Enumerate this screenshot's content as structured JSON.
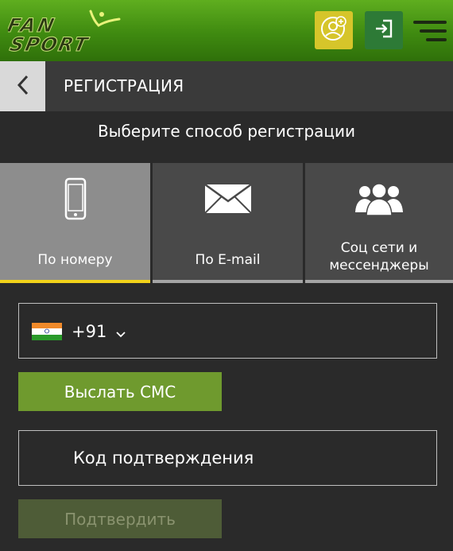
{
  "header": {
    "logo_text_top": "FAN",
    "logo_text_bottom": "SPORT",
    "profile_icon": "user-plus-icon",
    "login_icon": "login-icon",
    "menu_icon": "hamburger-menu-icon"
  },
  "titlebar": {
    "title": "РЕГИСТРАЦИЯ",
    "back_icon": "chevron-left-icon"
  },
  "subtitle": "Выберите способ регистрации",
  "tabs": [
    {
      "label_line1": "По номеру",
      "label_line2": "",
      "icon": "smartphone-icon",
      "active": true
    },
    {
      "label_line1": "По E-mail",
      "label_line2": "",
      "icon": "envelope-icon",
      "active": false
    },
    {
      "label_line1": "Соц сети и",
      "label_line2": "мессенджеры",
      "icon": "users-icon",
      "active": false
    }
  ],
  "phone": {
    "country_flag": "india-flag-icon",
    "code": "+91"
  },
  "send_sms_label": "Выслать СМС",
  "code_field": {
    "placeholder": "Код подтверждения",
    "value": ""
  },
  "confirm_label": "Подтвердить",
  "colors": {
    "header_green": "#4a9a18",
    "profile_yellow": "#d6c52a",
    "login_green": "#2d7a36",
    "active_tab_underline": "#f2d21a",
    "sms_button": "#6f9a2e",
    "confirm_button_disabled": "#4e5c37",
    "background": "#2a2a2a"
  }
}
